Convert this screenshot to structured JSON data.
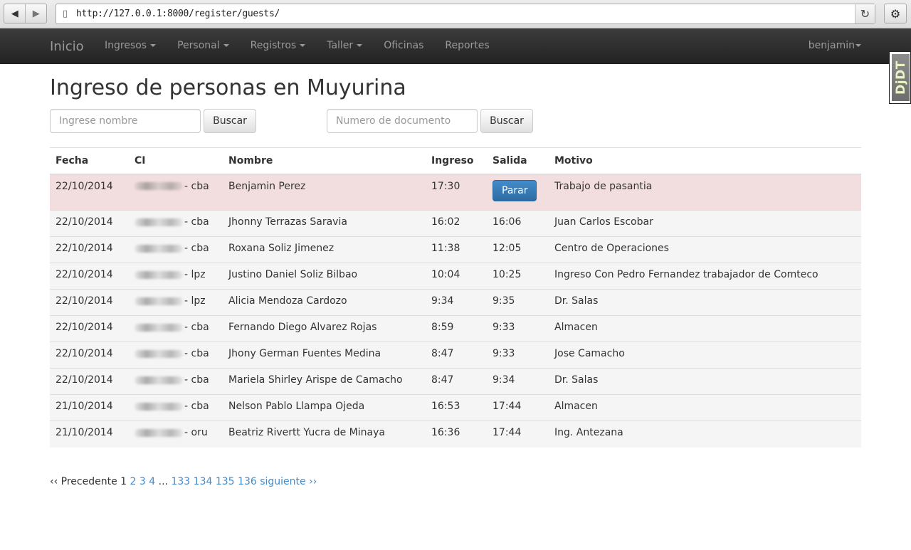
{
  "browser": {
    "back_icon": "◀",
    "forward_icon": "▶",
    "url": "http://127.0.0.1:8000/register/guests/",
    "reload_icon": "↻",
    "settings_icon": "⚙"
  },
  "navbar": {
    "brand": "Inicio",
    "menu": [
      {
        "label": "Ingresos",
        "dropdown": true
      },
      {
        "label": "Personal",
        "dropdown": true
      },
      {
        "label": "Registros",
        "dropdown": true
      },
      {
        "label": "Taller",
        "dropdown": true
      },
      {
        "label": "Oficinas",
        "dropdown": false
      },
      {
        "label": "Reportes",
        "dropdown": false
      }
    ],
    "user": "benjamin"
  },
  "djdt": {
    "label": "DjDT"
  },
  "page": {
    "title": "Ingreso de personas en Muyurina",
    "search_name": {
      "placeholder": "Ingrese nombre",
      "button": "Buscar"
    },
    "search_doc": {
      "placeholder": "Numero de documento",
      "button": "Buscar"
    }
  },
  "table": {
    "headers": [
      "Fecha",
      "CI",
      "Nombre",
      "Ingreso",
      "Salida",
      "Motivo"
    ],
    "rows": [
      {
        "fecha": "22/10/2014",
        "ci_suffix": "- cba",
        "nombre": "Benjamin Perez",
        "ingreso": "17:30",
        "salida": "",
        "action": "Parar",
        "motivo": "Trabajo de pasantia",
        "active": true
      },
      {
        "fecha": "22/10/2014",
        "ci_suffix": "- cba",
        "nombre": "Jhonny Terrazas Saravia",
        "ingreso": "16:02",
        "salida": "16:06",
        "motivo": "Juan Carlos Escobar"
      },
      {
        "fecha": "22/10/2014",
        "ci_suffix": "- cba",
        "nombre": "Roxana Soliz Jimenez",
        "ingreso": "11:38",
        "salida": "12:05",
        "motivo": "Centro de Operaciones"
      },
      {
        "fecha": "22/10/2014",
        "ci_suffix": "- lpz",
        "nombre": "Justino Daniel Soliz Bilbao",
        "ingreso": "10:04",
        "salida": "10:25",
        "motivo": "Ingreso Con Pedro Fernandez trabajador de Comteco"
      },
      {
        "fecha": "22/10/2014",
        "ci_suffix": "- lpz",
        "nombre": "Alicia Mendoza Cardozo",
        "ingreso": "9:34",
        "salida": "9:35",
        "motivo": "Dr. Salas"
      },
      {
        "fecha": "22/10/2014",
        "ci_suffix": "- cba",
        "nombre": "Fernando Diego Alvarez Rojas",
        "ingreso": "8:59",
        "salida": "9:33",
        "motivo": "Almacen"
      },
      {
        "fecha": "22/10/2014",
        "ci_suffix": "- cba",
        "nombre": "Jhony German Fuentes Medina",
        "ingreso": "8:47",
        "salida": "9:33",
        "motivo": "Jose Camacho"
      },
      {
        "fecha": "22/10/2014",
        "ci_suffix": "- cba",
        "nombre": "Mariela Shirley Arispe de Camacho",
        "ingreso": "8:47",
        "salida": "9:34",
        "motivo": "Dr. Salas"
      },
      {
        "fecha": "21/10/2014",
        "ci_suffix": "- cba",
        "nombre": "Nelson Pablo Llampa Ojeda",
        "ingreso": "16:53",
        "salida": "17:44",
        "motivo": "Almacen"
      },
      {
        "fecha": "21/10/2014",
        "ci_suffix": "- oru",
        "nombre": "Beatriz Rivertt Yucra de Minaya",
        "ingreso": "16:36",
        "salida": "17:44",
        "motivo": "Ing. Antezana"
      }
    ]
  },
  "pagination": {
    "prev": "‹‹ Precedente",
    "current": "1",
    "first_pages": [
      "2",
      "3",
      "4"
    ],
    "ellipsis": "...",
    "last_pages": [
      "133",
      "134",
      "135",
      "136"
    ],
    "next": "siguiente ››"
  },
  "colors": {
    "navbar": "#222222",
    "link": "#428bca",
    "primary_button": "#3071a9",
    "active_row": "#f2dede",
    "row": "#f5f5f5"
  }
}
